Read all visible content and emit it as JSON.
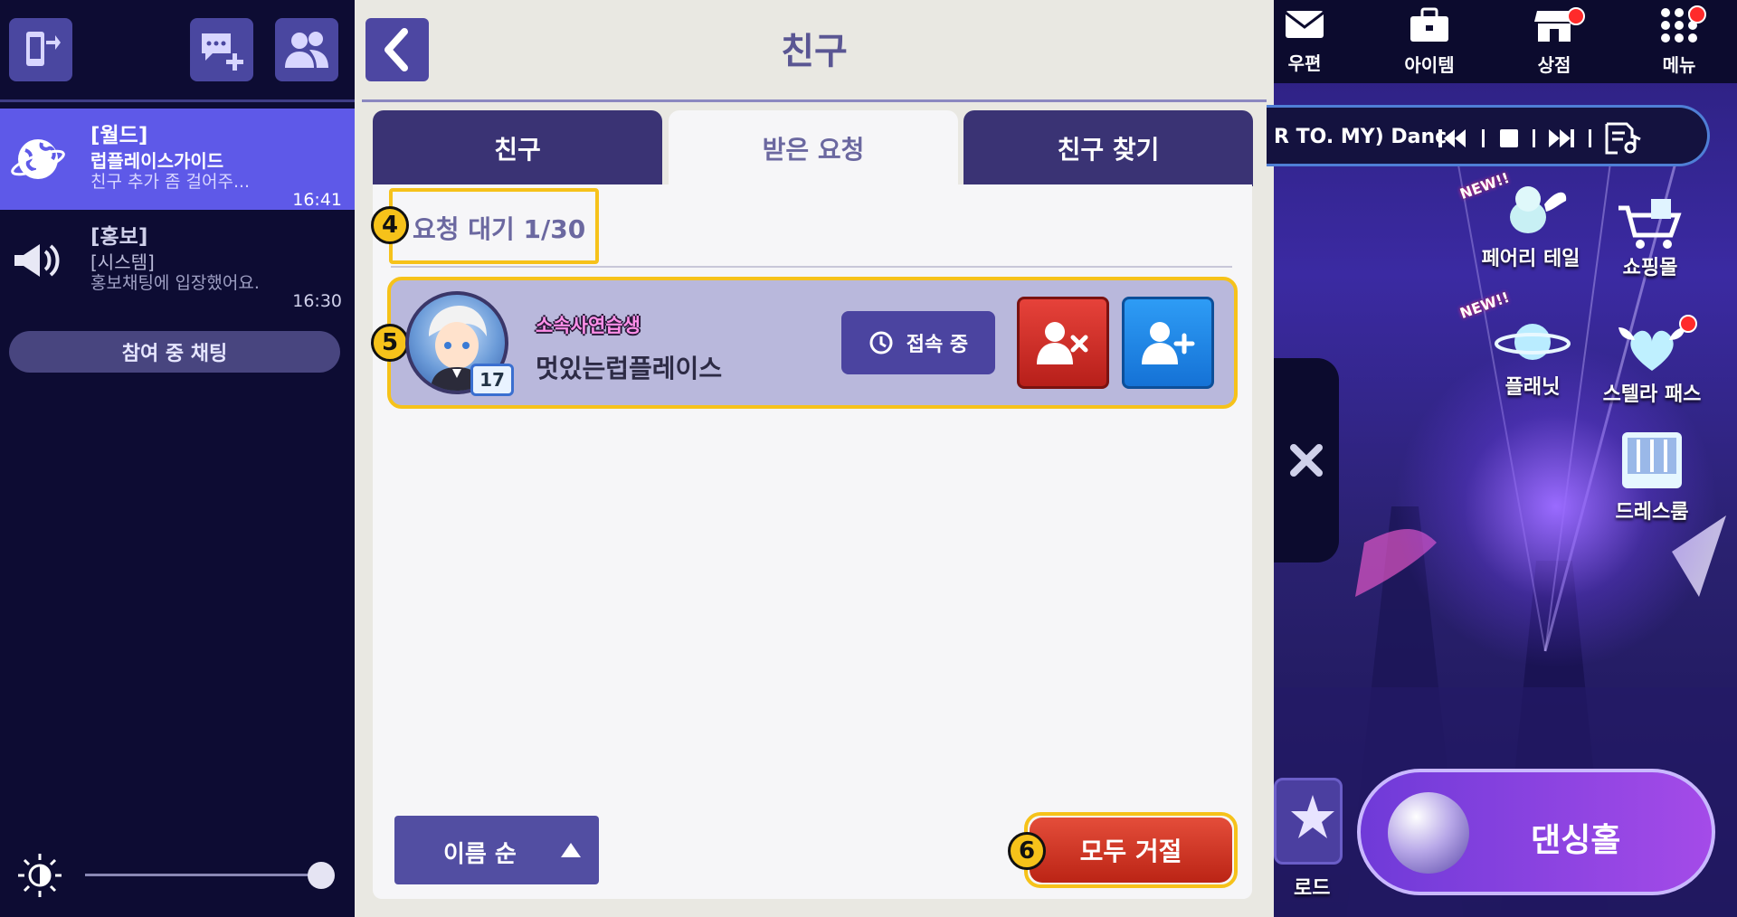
{
  "sidebar": {
    "chats": [
      {
        "channel": "[월드]",
        "sender": "럽플레이스가이드",
        "message": "친구 추가 좀 걸어주...",
        "time": "16:41",
        "icon": "globe-icon"
      },
      {
        "channel": "[홍보]",
        "sender": "[시스템]",
        "message": "홍보채팅에 입장했어요.",
        "time": "16:30",
        "icon": "megaphone-icon"
      }
    ],
    "joined_chat_button": "참여 중 채팅",
    "brightness_level": 1.0
  },
  "panel": {
    "title": "친구",
    "tabs": [
      {
        "label": "친구",
        "active": false
      },
      {
        "label": "받은 요청",
        "active": true
      },
      {
        "label": "친구 찾기",
        "active": false
      }
    ],
    "request_count": "요청 대기 1/30",
    "annotations": {
      "count": "4",
      "row": "5",
      "reject_all": "6"
    },
    "requests": [
      {
        "rank": "소속사연습생",
        "name": "멋있는럽플레이스",
        "level": "17",
        "status": "접속 중"
      }
    ],
    "sort_label": "이름 순",
    "reject_all": "모두 거절"
  },
  "game": {
    "top_menu": [
      {
        "label": "우편",
        "icon": "mail-icon",
        "dot": false
      },
      {
        "label": "아이템",
        "icon": "bag-icon",
        "dot": false
      },
      {
        "label": "상점",
        "icon": "shop-icon",
        "dot": true
      },
      {
        "label": "메뉴",
        "icon": "menu-grid-icon",
        "dot": true
      }
    ],
    "music_text": "R TO. MY) Danc",
    "icons": [
      {
        "label": "페어리 테일",
        "new": "NEW!!"
      },
      {
        "label": "쇼핑몰"
      },
      {
        "label": "플래닛",
        "new": "NEW!!"
      },
      {
        "label": "스텔라 패스"
      },
      {
        "label": "드레스룸"
      }
    ],
    "road_label": "로드",
    "dance_button": "댄싱홀",
    "colors": {
      "accent": "#5e59e8",
      "highlight": "#f6c21a",
      "reject": "#c72e22",
      "accept": "#1f86e8"
    }
  }
}
